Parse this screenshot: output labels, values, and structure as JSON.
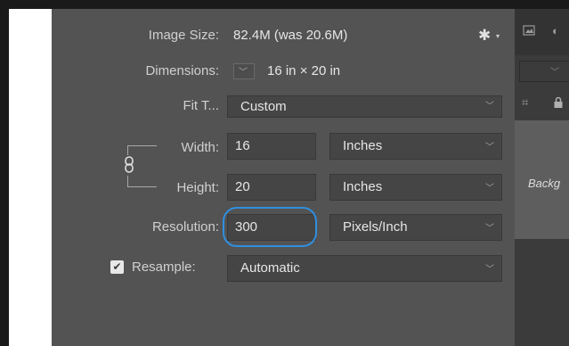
{
  "dialog": {
    "image_size_label": "Image Size:",
    "image_size_value": "82.4M (was 20.6M)",
    "dimensions_label": "Dimensions:",
    "dimensions_value": "16 in  ×  20 in",
    "fit_to_label": "Fit T...",
    "fit_to_value": "Custom",
    "width_label": "Width:",
    "width_value": "16",
    "width_unit": "Inches",
    "height_label": "Height:",
    "height_value": "20",
    "height_unit": "Inches",
    "resolution_label": "Resolution:",
    "resolution_value": "300",
    "resolution_unit": "Pixels/Inch",
    "resample_label": "Resample:",
    "resample_checked": true,
    "resample_value": "Automatic"
  },
  "right_panel": {
    "layer_name": "Backg"
  },
  "icons": {
    "settings": "gear-icon",
    "constrain": "chain-link-icon",
    "image": "image-icon",
    "lock": "lock-icon"
  },
  "colors": {
    "focus_ring": "#2f8fe0",
    "dialog_bg": "#535353"
  }
}
